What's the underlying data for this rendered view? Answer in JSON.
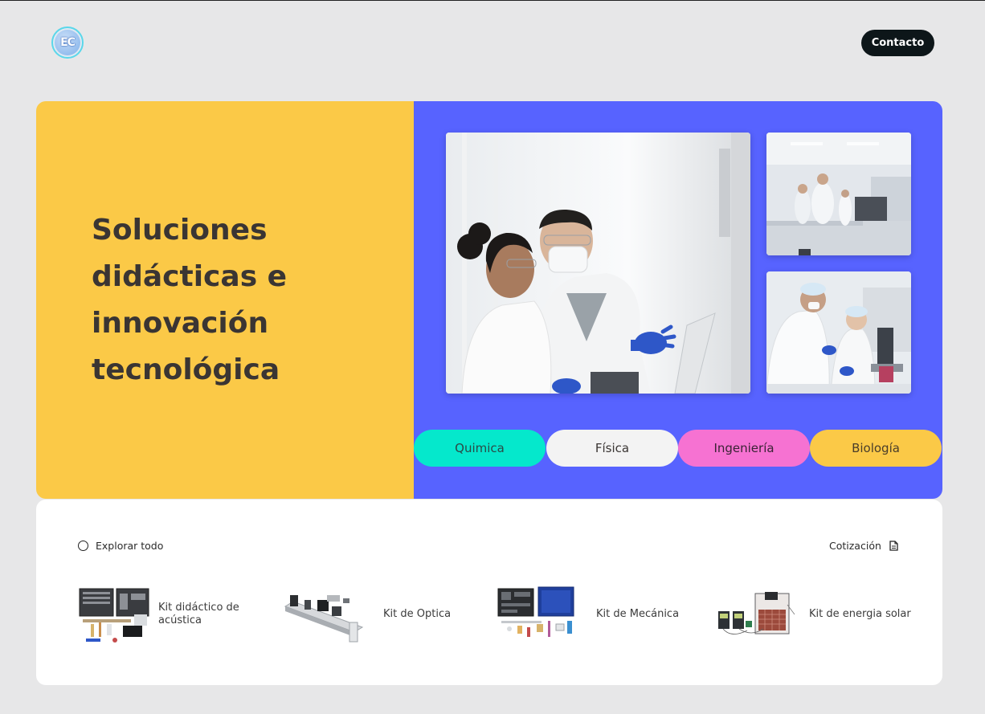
{
  "header": {
    "logo_text": "EC",
    "contact_label": "Contacto"
  },
  "hero": {
    "title_line1": "Soluciones",
    "title_line2_bold": "didácticas",
    "title_line2_rest": " e",
    "title_line3_bold": "innovación",
    "title_line4": "tecnológica",
    "colors": {
      "left_panel": "#fbc947",
      "right_panel": "#5763ff"
    },
    "categories": [
      {
        "label": "Quimica",
        "color": "#05e8cc"
      },
      {
        "label": "Física",
        "color": "#f3f3f3"
      },
      {
        "label": "Ingeniería",
        "color": "#f672d2"
      },
      {
        "label": "Biología",
        "color": "#fbc947"
      }
    ]
  },
  "catalog": {
    "explore_label": "Explorar todo",
    "quote_label": "Cotización",
    "explore_icon": "circle-icon",
    "quote_icon": "document-icon",
    "kits": [
      {
        "label": "Kit didáctico de acústica"
      },
      {
        "label": "Kit de Optica"
      },
      {
        "label": "Kit de Mecánica"
      },
      {
        "label": "Kit de energia solar"
      }
    ]
  }
}
